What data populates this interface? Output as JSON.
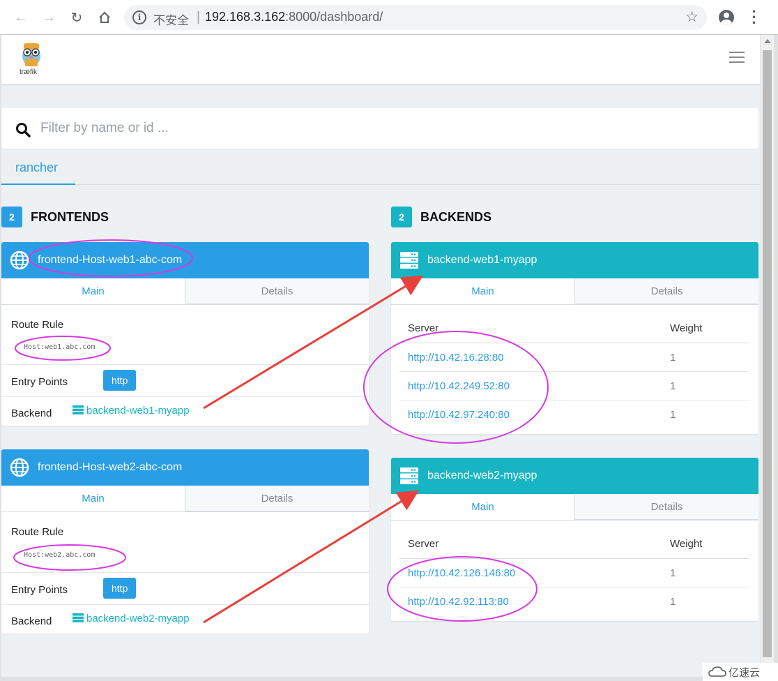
{
  "browser": {
    "security_label": "不安全",
    "url_host": "192.168.3.162",
    "url_rest": ":8000/dashboard/"
  },
  "app": {
    "logo_text": "træfik"
  },
  "search": {
    "placeholder": "Filter by name or id ..."
  },
  "tabs": [
    "rancher"
  ],
  "colors": {
    "primary": "#2a9ee4",
    "backend": "#17b4c4",
    "annotation": "#d63be0",
    "arrow": "#e8403a"
  },
  "frontends": {
    "count": "2",
    "title": "FRONTENDS",
    "items": [
      {
        "name": "frontend-Host-web1-abc-com",
        "tab_main": "Main",
        "tab_details": "Details",
        "route_label": "Route Rule",
        "route_value": "Host:web1.abc.com",
        "entry_label": "Entry Points",
        "entry_value": "http",
        "backend_label": "Backend",
        "backend_value": "backend-web1-myapp"
      },
      {
        "name": "frontend-Host-web2-abc-com",
        "tab_main": "Main",
        "tab_details": "Details",
        "route_label": "Route Rule",
        "route_value": "Host:web2.abc.com",
        "entry_label": "Entry Points",
        "entry_value": "http",
        "backend_label": "Backend",
        "backend_value": "backend-web2-myapp"
      }
    ]
  },
  "backends": {
    "count": "2",
    "title": "BACKENDS",
    "items": [
      {
        "name": "backend-web1-myapp",
        "tab_main": "Main",
        "tab_details": "Details",
        "col_server": "Server",
        "col_weight": "Weight",
        "servers": [
          {
            "url": "http://10.42.16.28:80",
            "weight": "1"
          },
          {
            "url": "http://10.42.249.52:80",
            "weight": "1"
          },
          {
            "url": "http://10.42.97.240:80",
            "weight": "1"
          }
        ]
      },
      {
        "name": "backend-web2-myapp",
        "tab_main": "Main",
        "tab_details": "Details",
        "col_server": "Server",
        "col_weight": "Weight",
        "servers": [
          {
            "url": "http://10.42.126.146:80",
            "weight": "1"
          },
          {
            "url": "http://10.42.92.113:80",
            "weight": "1"
          }
        ]
      }
    ]
  },
  "watermark": "亿速云"
}
